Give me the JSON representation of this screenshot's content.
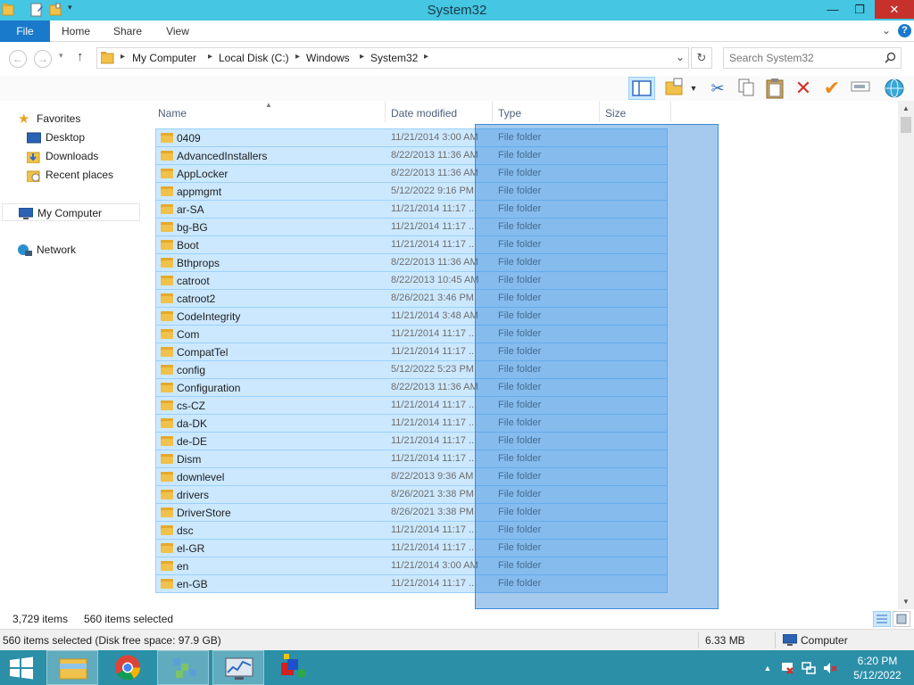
{
  "window": {
    "title": "System32",
    "minimize_glyph": "—",
    "maximize_glyph": "❐",
    "close_glyph": "✕"
  },
  "ribbon": {
    "tabs": [
      "File",
      "Home",
      "Share",
      "View"
    ],
    "expand_glyph": "⌄",
    "help_glyph": "?"
  },
  "address": {
    "back_glyph": "←",
    "forward_glyph": "→",
    "up_glyph": "↑",
    "breadcrumbs": [
      "My Computer",
      "Local Disk (C:)",
      "Windows",
      "System32"
    ],
    "separator": "▸",
    "dropdown_glyph": "⌄",
    "refresh_glyph": "↻"
  },
  "search": {
    "placeholder": "Search System32",
    "icon": "search-icon"
  },
  "toolbar": {
    "icons": [
      "preview-pane-icon",
      "new-folder-icon",
      "dropdown-arrow-icon",
      "cut-icon",
      "copy-icon",
      "paste-icon",
      "delete-icon",
      "check-icon",
      "rename-icon",
      "globe-icon"
    ]
  },
  "navigation": {
    "favorites": "Favorites",
    "desktop": "Desktop",
    "downloads": "Downloads",
    "recent_places": "Recent places",
    "my_computer": "My Computer",
    "network": "Network"
  },
  "columns": {
    "name": "Name",
    "date_modified": "Date modified",
    "type": "Type",
    "size": "Size"
  },
  "files": [
    {
      "name": "0409",
      "date": "11/21/2014 3:00 AM",
      "type": "File folder"
    },
    {
      "name": "AdvancedInstallers",
      "date": "8/22/2013 11:36 AM",
      "type": "File folder"
    },
    {
      "name": "AppLocker",
      "date": "8/22/2013 11:36 AM",
      "type": "File folder"
    },
    {
      "name": "appmgmt",
      "date": "5/12/2022 9:16 PM",
      "type": "File folder"
    },
    {
      "name": "ar-SA",
      "date": "11/21/2014 11:17 ...",
      "type": "File folder"
    },
    {
      "name": "bg-BG",
      "date": "11/21/2014 11:17 ...",
      "type": "File folder"
    },
    {
      "name": "Boot",
      "date": "11/21/2014 11:17 ...",
      "type": "File folder"
    },
    {
      "name": "Bthprops",
      "date": "8/22/2013 11:36 AM",
      "type": "File folder"
    },
    {
      "name": "catroot",
      "date": "8/22/2013 10:45 AM",
      "type": "File folder"
    },
    {
      "name": "catroot2",
      "date": "8/26/2021 3:46 PM",
      "type": "File folder"
    },
    {
      "name": "CodeIntegrity",
      "date": "11/21/2014 3:48 AM",
      "type": "File folder"
    },
    {
      "name": "Com",
      "date": "11/21/2014 11:17 ...",
      "type": "File folder"
    },
    {
      "name": "CompatTel",
      "date": "11/21/2014 11:17 ...",
      "type": "File folder"
    },
    {
      "name": "config",
      "date": "5/12/2022 5:23 PM",
      "type": "File folder"
    },
    {
      "name": "Configuration",
      "date": "8/22/2013 11:36 AM",
      "type": "File folder"
    },
    {
      "name": "cs-CZ",
      "date": "11/21/2014 11:17 ...",
      "type": "File folder"
    },
    {
      "name": "da-DK",
      "date": "11/21/2014 11:17 ...",
      "type": "File folder"
    },
    {
      "name": "de-DE",
      "date": "11/21/2014 11:17 ...",
      "type": "File folder"
    },
    {
      "name": "Dism",
      "date": "11/21/2014 11:17 ...",
      "type": "File folder"
    },
    {
      "name": "downlevel",
      "date": "8/22/2013 9:36 AM",
      "type": "File folder"
    },
    {
      "name": "drivers",
      "date": "8/26/2021 3:38 PM",
      "type": "File folder"
    },
    {
      "name": "DriverStore",
      "date": "8/26/2021 3:38 PM",
      "type": "File folder"
    },
    {
      "name": "dsc",
      "date": "11/21/2014 11:17 ...",
      "type": "File folder"
    },
    {
      "name": "el-GR",
      "date": "11/21/2014 11:17 ...",
      "type": "File folder"
    },
    {
      "name": "en",
      "date": "11/21/2014 3:00 AM",
      "type": "File folder"
    },
    {
      "name": "en-GB",
      "date": "11/21/2014 11:17 ...",
      "type": "File folder"
    }
  ],
  "status": {
    "item_count": "3,729 items",
    "selected_count": "560 items selected"
  },
  "statusbar": {
    "summary": "560 items selected (Disk free space: 97.9 GB)",
    "size": "6.33 MB",
    "location": "Computer"
  },
  "taskbar": {
    "time": "6:20 PM",
    "date": "5/12/2022",
    "apps": [
      "start-icon",
      "file-explorer-icon",
      "chrome-icon",
      "network-app-icon",
      "performance-monitor-icon",
      "paint-app-icon"
    ]
  },
  "colors": {
    "titlebar": "#45c6e2",
    "file_tab": "#1979ca",
    "close_button": "#c7312b",
    "selection_fill": "#cce8ff",
    "selection_border": "#99d1ff",
    "taskbar": "#2b8fa8",
    "folder": "#f0c14b"
  }
}
